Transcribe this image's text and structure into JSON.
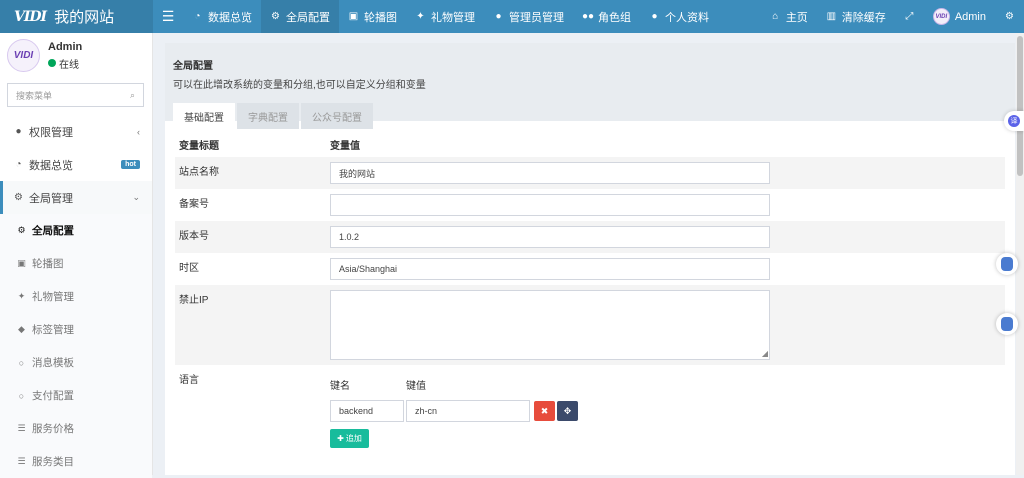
{
  "brand": {
    "logo": "VIDI",
    "site_name": "我的网站"
  },
  "topnav": {
    "items": [
      {
        "label": "数据总览",
        "icon": "dashboard-icon"
      },
      {
        "label": "全局配置",
        "icon": "gear-icon",
        "active": true
      },
      {
        "label": "轮播图",
        "icon": "image-icon"
      },
      {
        "label": "礼物管理",
        "icon": "gift-icon"
      },
      {
        "label": "管理员管理",
        "icon": "user-icon"
      },
      {
        "label": "角色组",
        "icon": "group-icon"
      },
      {
        "label": "个人资料",
        "icon": "user-icon"
      }
    ],
    "right": {
      "home": "主页",
      "clear_cache": "清除缓存",
      "admin": "Admin"
    }
  },
  "sidebar": {
    "user": {
      "name": "Admin",
      "status": "在线"
    },
    "search_placeholder": "搜索菜单",
    "items": [
      {
        "label": "权限管理",
        "icon": "users-icon"
      },
      {
        "label": "数据总览",
        "icon": "dashboard-icon",
        "badge": "hot"
      },
      {
        "label": "全局管理",
        "icon": "gears-icon"
      }
    ],
    "sub_items": [
      {
        "label": "全局配置",
        "icon": "gear-icon",
        "active": true
      },
      {
        "label": "轮播图",
        "icon": "image-icon"
      },
      {
        "label": "礼物管理",
        "icon": "gift-icon"
      },
      {
        "label": "标签管理",
        "icon": "tag-icon"
      },
      {
        "label": "消息模板",
        "icon": "circle-icon"
      },
      {
        "label": "支付配置",
        "icon": "circle-icon"
      },
      {
        "label": "服务价格",
        "icon": "list-icon"
      },
      {
        "label": "服务类目",
        "icon": "list-icon"
      }
    ]
  },
  "content": {
    "title": "全局配置",
    "description": "可以在此增改系统的变量和分组,也可以自定义分组和变量",
    "tabs": [
      "基础配置",
      "字典配置",
      "公众号配置"
    ],
    "table_headers": {
      "name": "变量标题",
      "value": "变量值"
    },
    "rows": {
      "site_name": {
        "label": "站点名称",
        "value": "我的网站"
      },
      "beian": {
        "label": "备案号",
        "value": ""
      },
      "version": {
        "label": "版本号",
        "value": "1.0.2"
      },
      "timezone": {
        "label": "时区",
        "value": "Asia/Shanghai"
      },
      "forbidden_ip": {
        "label": "禁止IP",
        "value": ""
      },
      "language": {
        "label": "语言",
        "key_header": "键名",
        "value_header": "键值",
        "key": "backend",
        "value": "zh-cn",
        "add_label": "追加"
      }
    }
  },
  "floating": {
    "translate": "译"
  },
  "colors": {
    "primary": "#3c8dbc",
    "success": "#18bc9c",
    "danger": "#e74c3c",
    "online": "#00a65a"
  }
}
